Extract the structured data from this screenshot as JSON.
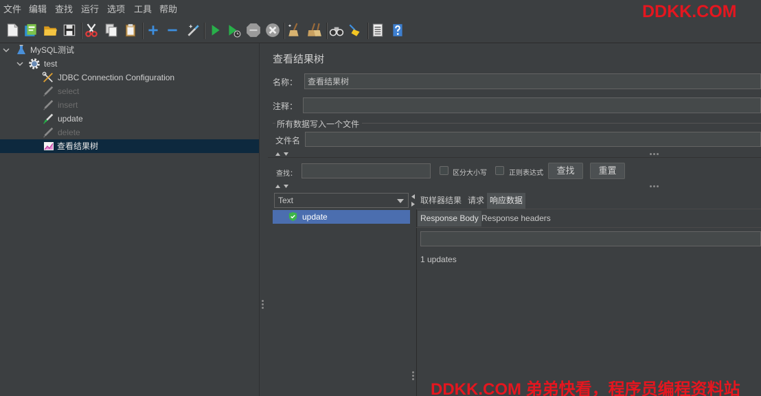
{
  "menu": {
    "items": [
      {
        "label": "文件"
      },
      {
        "label": "编辑"
      },
      {
        "label": "查找"
      },
      {
        "label": "运行"
      },
      {
        "label": "选项"
      },
      {
        "label": "工具"
      },
      {
        "label": "帮助"
      }
    ]
  },
  "watermark": {
    "top": "DDKK.COM",
    "bottom": "DDKK.COM 弟弟快看，程序员编程资料站"
  },
  "toolbar": {
    "icons": [
      "new-icon",
      "templates-icon",
      "open-icon",
      "save-icon",
      "cut-icon",
      "copy-icon",
      "paste-icon",
      "expand-icon",
      "collapse-icon",
      "toggle-icon",
      "start-icon",
      "start-no-pauses-icon",
      "stop-icon",
      "shutdown-icon",
      "clear-icon",
      "clear-all-icon",
      "search-icon",
      "reset-search-icon",
      "function-helper-icon",
      "help-icon"
    ]
  },
  "tree": [
    {
      "label": "MySQL测试",
      "icon": "flask-icon",
      "expanded": true
    },
    {
      "label": "test",
      "icon": "gear-icon",
      "expanded": true
    },
    {
      "label": "JDBC Connection Configuration",
      "icon": "wrench-icon"
    },
    {
      "label": "select",
      "icon": "pencil-icon",
      "enabled": false
    },
    {
      "label": "insert",
      "icon": "pencil-icon",
      "enabled": false
    },
    {
      "label": "update",
      "icon": "pencil-icon",
      "enabled": true
    },
    {
      "label": "delete",
      "icon": "pencil-icon",
      "enabled": false
    },
    {
      "label": "查看结果树",
      "icon": "chart-icon",
      "selected": true
    }
  ],
  "panel": {
    "title": "查看结果树",
    "name_label": "名称：",
    "name_value": "查看结果树",
    "comment_label": "注释：",
    "comment_value": "",
    "file_group_label": "所有数据写入一个文件",
    "filename_label": "文件名",
    "filename_value": "",
    "search": {
      "label": "查找：",
      "value": "",
      "case_label": "区分大小写",
      "case_checked": false,
      "regex_label": "正则表达式",
      "regex_checked": false,
      "find_button": "查找",
      "reset_button": "重置"
    }
  },
  "results": {
    "renderer": "Text",
    "samples": [
      {
        "label": "update",
        "status": "success",
        "icon": "shield-check-icon"
      }
    ],
    "tabs": [
      {
        "label": "取样器结果"
      },
      {
        "label": "请求"
      },
      {
        "label": "响应数据",
        "active": true
      }
    ],
    "subtabs": [
      {
        "label": "Response Body",
        "active": true
      },
      {
        "label": "Response headers"
      }
    ],
    "response_search_value": "",
    "response_text": "1 updates"
  },
  "colors": {
    "background": "#3c3f41",
    "foreground": "#bbbbbb",
    "tree_selection": "#0d293e",
    "list_selection": "#4b6eaf",
    "watermark": "#e5161f",
    "run_green": "#28b04a",
    "accent_blue": "#3d8fe0"
  }
}
